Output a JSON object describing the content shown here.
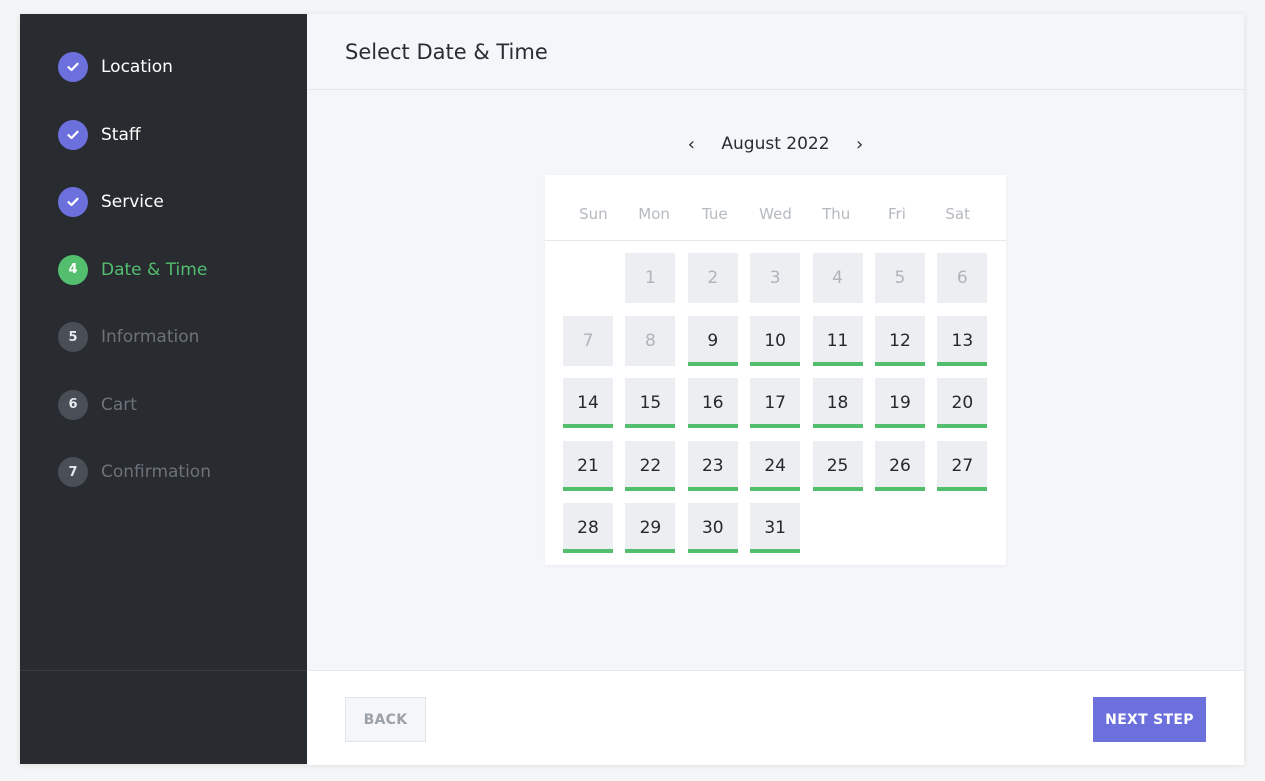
{
  "sidebar": {
    "steps": [
      {
        "number": "1",
        "label": "Location",
        "state": "done",
        "icon": "check-icon"
      },
      {
        "number": "2",
        "label": "Staff",
        "state": "done",
        "icon": "check-icon"
      },
      {
        "number": "3",
        "label": "Service",
        "state": "done",
        "icon": "check-icon"
      },
      {
        "number": "4",
        "label": "Date & Time",
        "state": "active"
      },
      {
        "number": "5",
        "label": "Information",
        "state": "todo"
      },
      {
        "number": "6",
        "label": "Cart",
        "state": "todo"
      },
      {
        "number": "7",
        "label": "Confirmation",
        "state": "todo"
      }
    ]
  },
  "header": {
    "title": "Select Date & Time"
  },
  "calendar": {
    "month_label": "August 2022",
    "prev_icon": "chevron-left-icon",
    "next_icon": "chevron-right-icon",
    "weekdays": [
      "Sun",
      "Mon",
      "Tue",
      "Wed",
      "Thu",
      "Fri",
      "Sat"
    ],
    "leading_empty": 1,
    "days": [
      {
        "n": "1",
        "state": "disabled"
      },
      {
        "n": "2",
        "state": "disabled"
      },
      {
        "n": "3",
        "state": "disabled"
      },
      {
        "n": "4",
        "state": "disabled"
      },
      {
        "n": "5",
        "state": "disabled"
      },
      {
        "n": "6",
        "state": "disabled"
      },
      {
        "n": "7",
        "state": "disabled"
      },
      {
        "n": "8",
        "state": "disabled"
      },
      {
        "n": "9",
        "state": "available"
      },
      {
        "n": "10",
        "state": "available"
      },
      {
        "n": "11",
        "state": "available"
      },
      {
        "n": "12",
        "state": "available"
      },
      {
        "n": "13",
        "state": "available"
      },
      {
        "n": "14",
        "state": "available"
      },
      {
        "n": "15",
        "state": "available"
      },
      {
        "n": "16",
        "state": "available"
      },
      {
        "n": "17",
        "state": "available"
      },
      {
        "n": "18",
        "state": "available"
      },
      {
        "n": "19",
        "state": "available"
      },
      {
        "n": "20",
        "state": "available"
      },
      {
        "n": "21",
        "state": "available"
      },
      {
        "n": "22",
        "state": "available"
      },
      {
        "n": "23",
        "state": "available"
      },
      {
        "n": "24",
        "state": "available"
      },
      {
        "n": "25",
        "state": "available"
      },
      {
        "n": "26",
        "state": "available"
      },
      {
        "n": "27",
        "state": "available"
      },
      {
        "n": "28",
        "state": "available"
      },
      {
        "n": "29",
        "state": "available"
      },
      {
        "n": "30",
        "state": "available"
      },
      {
        "n": "31",
        "state": "available"
      }
    ]
  },
  "footer": {
    "back_label": "BACK",
    "next_label": "NEXT STEP"
  },
  "colors": {
    "sidebar_bg": "#282b30",
    "accent_purple": "#6c70dc",
    "active_green": "#53be6e",
    "main_bg": "#f5f6fa"
  }
}
